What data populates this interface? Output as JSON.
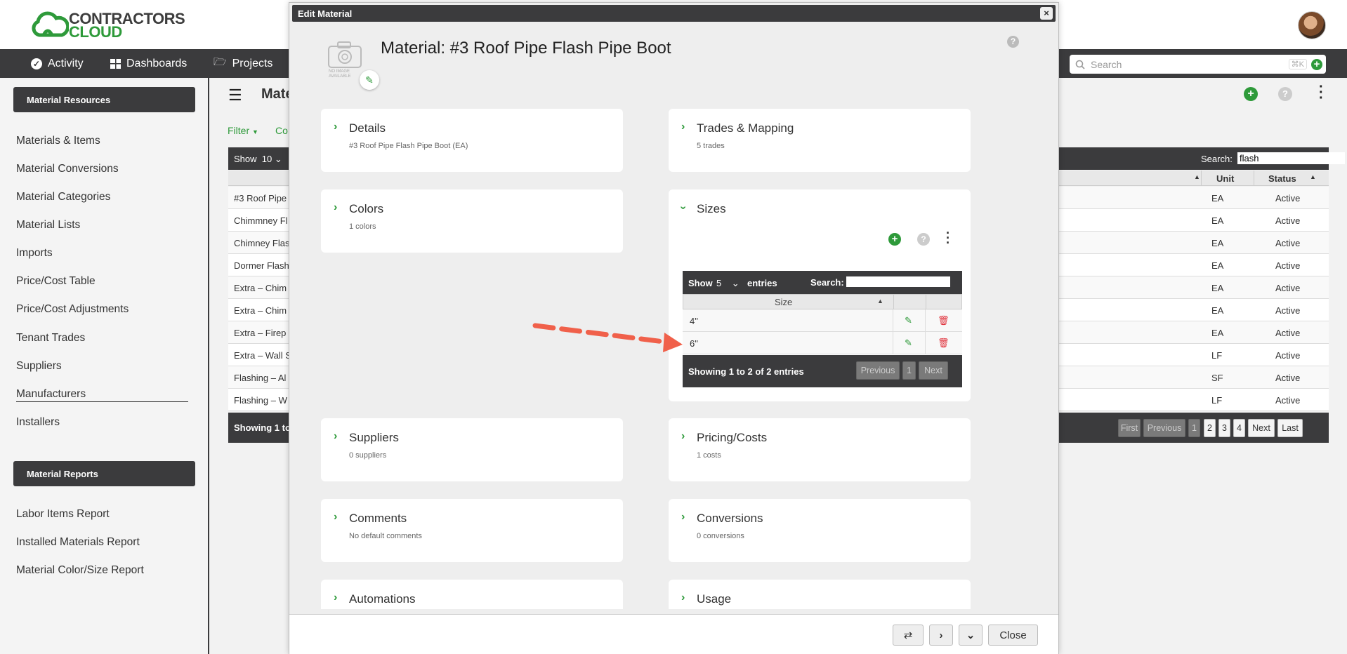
{
  "brand": {
    "line1": "CONTRACTORS",
    "line2": "CLOUD",
    "green": "#2e9a3a",
    "dark": "#3b3b3d"
  },
  "nav": {
    "items": [
      {
        "label": "Activity",
        "icon": "check-circle-icon"
      },
      {
        "label": "Dashboards",
        "icon": "grid-icon"
      },
      {
        "label": "Projects",
        "icon": "folder-icon"
      }
    ],
    "search_placeholder": "Search",
    "search_shortcut": "⌘K"
  },
  "sidebar": {
    "resources_heading": "Material Resources",
    "resources": [
      "Materials & Items",
      "Material Conversions",
      "Material Categories",
      "Material Lists",
      "Imports",
      "Price/Cost Table",
      "Price/Cost Adjustments",
      "Tenant Trades",
      "Suppliers",
      "Manufacturers",
      "Installers"
    ],
    "reports_heading": "Material Reports",
    "reports": [
      "Labor Items Report",
      "Installed Materials Report",
      "Material Color/Size Report"
    ]
  },
  "background_table": {
    "title": "Mate",
    "filter_label": "Filter",
    "co_label": "Co",
    "show_label": "Show",
    "show_value": "10",
    "search_label": "Search:",
    "search_value": "flash",
    "columns": {
      "unit": "Unit",
      "status": "Status"
    },
    "rows": [
      {
        "name": "#3 Roof Pipe",
        "unit": "EA",
        "status": "Active"
      },
      {
        "name": "Chimmney Fl",
        "unit": "EA",
        "status": "Active"
      },
      {
        "name": "Chimney Flas",
        "unit": "EA",
        "status": "Active"
      },
      {
        "name": "Dormer Flash",
        "unit": "EA",
        "status": "Active"
      },
      {
        "name": "Extra – Chim",
        "unit": "EA",
        "status": "Active"
      },
      {
        "name": "Extra – Chim",
        "unit": "EA",
        "status": "Active"
      },
      {
        "name": "Extra – Firep",
        "unit": "EA",
        "status": "Active"
      },
      {
        "name": "Extra – Wall S",
        "unit": "LF",
        "status": "Active"
      },
      {
        "name": "Flashing – Al",
        "unit": "SF",
        "status": "Active"
      },
      {
        "name": "Flashing – W",
        "unit": "LF",
        "status": "Active"
      }
    ],
    "footer_text": "Showing 1 to",
    "pagination": [
      "First",
      "Previous",
      "1",
      "2",
      "3",
      "4",
      "Next",
      "Last"
    ]
  },
  "modal": {
    "title": "Edit Material",
    "close_glyph": "×",
    "no_image_text": "NO IMAGE AVAILABLE",
    "material_title": "Material: #3 Roof Pipe Flash Pipe Boot",
    "cards": {
      "details": {
        "title": "Details",
        "sub": "#3 Roof Pipe Flash Pipe Boot (EA)"
      },
      "trades": {
        "title": "Trades & Mapping",
        "sub": "5 trades"
      },
      "colors": {
        "title": "Colors",
        "sub": "1 colors"
      },
      "sizes": {
        "title": "Sizes"
      },
      "suppliers": {
        "title": "Suppliers",
        "sub": "0 suppliers"
      },
      "pricing": {
        "title": "Pricing/Costs",
        "sub": "1 costs"
      },
      "comments": {
        "title": "Comments",
        "sub": "No default comments"
      },
      "conversions": {
        "title": "Conversions",
        "sub": "0 conversions"
      },
      "automations": {
        "title": "Automations"
      },
      "usage": {
        "title": "Usage"
      }
    },
    "sizes_table": {
      "show_label": "Show",
      "show_value": "5",
      "entries_label": "entries",
      "search_label": "Search:",
      "column": "Size",
      "rows": [
        "4\"",
        "6\""
      ],
      "info": "Showing 1 to 2 of 2 entries",
      "prev": "Previous",
      "page": "1",
      "next": "Next"
    },
    "footer": {
      "close_label": "Close"
    }
  }
}
